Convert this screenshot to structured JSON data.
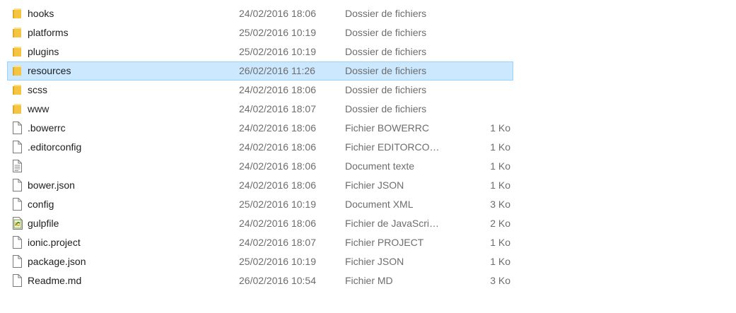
{
  "files": [
    {
      "name": "hooks",
      "date": "24/02/2016 18:06",
      "type": "Dossier de fichiers",
      "size": "",
      "icon": "folder-icon"
    },
    {
      "name": "platforms",
      "date": "25/02/2016 10:19",
      "type": "Dossier de fichiers",
      "size": "",
      "icon": "folder-icon"
    },
    {
      "name": "plugins",
      "date": "25/02/2016 10:19",
      "type": "Dossier de fichiers",
      "size": "",
      "icon": "folder-icon"
    },
    {
      "name": "resources",
      "date": "26/02/2016 11:26",
      "type": "Dossier de fichiers",
      "size": "",
      "icon": "folder-icon",
      "selected": true
    },
    {
      "name": "scss",
      "date": "24/02/2016 18:06",
      "type": "Dossier de fichiers",
      "size": "",
      "icon": "folder-icon"
    },
    {
      "name": "www",
      "date": "24/02/2016 18:07",
      "type": "Dossier de fichiers",
      "size": "",
      "icon": "folder-icon"
    },
    {
      "name": ".bowerrc",
      "date": "24/02/2016 18:06",
      "type": "Fichier BOWERRC",
      "size": "1 Ko",
      "icon": "file-icon"
    },
    {
      "name": ".editorconfig",
      "date": "24/02/2016 18:06",
      "type": "Fichier EDITORCO…",
      "size": "1 Ko",
      "icon": "file-icon"
    },
    {
      "name": "",
      "date": "24/02/2016 18:06",
      "type": "Document texte",
      "size": "1 Ko",
      "icon": "text-file-icon"
    },
    {
      "name": "bower.json",
      "date": "24/02/2016 18:06",
      "type": "Fichier JSON",
      "size": "1 Ko",
      "icon": "file-icon"
    },
    {
      "name": "config",
      "date": "25/02/2016 10:19",
      "type": "Document XML",
      "size": "3 Ko",
      "icon": "file-icon"
    },
    {
      "name": "gulpfile",
      "date": "24/02/2016 18:06",
      "type": "Fichier de JavaScri…",
      "size": "2 Ko",
      "icon": "javascript-file-icon"
    },
    {
      "name": "ionic.project",
      "date": "24/02/2016 18:07",
      "type": "Fichier PROJECT",
      "size": "1 Ko",
      "icon": "file-icon"
    },
    {
      "name": "package.json",
      "date": "25/02/2016 10:19",
      "type": "Fichier JSON",
      "size": "1 Ko",
      "icon": "file-icon"
    },
    {
      "name": "Readme.md",
      "date": "26/02/2016 10:54",
      "type": "Fichier MD",
      "size": "3 Ko",
      "icon": "file-icon"
    }
  ],
  "colors": {
    "selection_bg": "#cce8ff",
    "selection_border": "#99d1ff",
    "folder": "#f5c542"
  }
}
